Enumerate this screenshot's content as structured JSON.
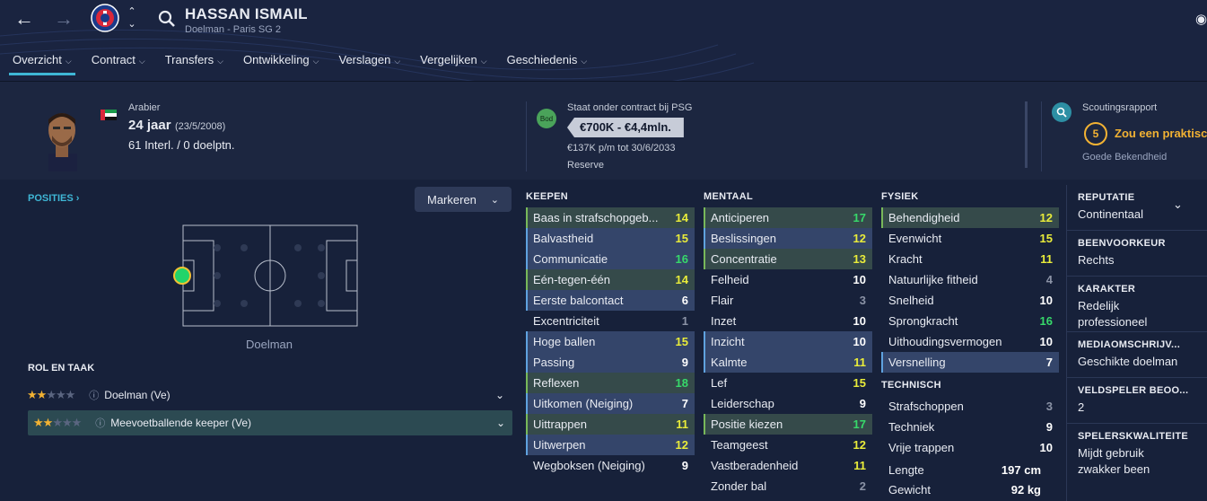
{
  "player": {
    "name": "HASSAN ISMAIL",
    "subtitle": "Doelman - Paris SG 2",
    "nationality": "Arabier",
    "age": "24 jaar",
    "dob": "(23/5/2008)",
    "caps": "61 Interl. / 0 doelptn."
  },
  "tabs": [
    {
      "label": "Overzicht"
    },
    {
      "label": "Contract"
    },
    {
      "label": "Transfers"
    },
    {
      "label": "Ontwikkeling"
    },
    {
      "label": "Verslagen"
    },
    {
      "label": "Vergelijken"
    },
    {
      "label": "Geschiedenis"
    }
  ],
  "contract": {
    "badge": "Bod",
    "heading": "Staat onder contract bij PSG",
    "value": "€700K - €4,4mln.",
    "wage": "€137K p/m tot 30/6/2033",
    "status": "Reserve"
  },
  "scouting": {
    "heading": "Scoutingsrapport",
    "score": "5",
    "verdict": "Zou een praktisc",
    "familiarity": "Goede Bekendheid"
  },
  "positions": {
    "title": "POSITIES",
    "mark_button": "Markeren",
    "position_label": "Doelman"
  },
  "role": {
    "title": "ROL EN TAAK",
    "roles": [
      {
        "label": "Doelman (Ve)",
        "stars": 2
      },
      {
        "label": "Meevoetballende keeper (Ve)",
        "stars": 2
      }
    ]
  },
  "attributes": {
    "keepen": {
      "title": "KEEPEN",
      "items": [
        {
          "name": "Baas in strafschopgeb...",
          "value": "14",
          "color": "y",
          "hl": "gr"
        },
        {
          "name": "Balvastheid",
          "value": "15",
          "color": "y",
          "hl": "hl"
        },
        {
          "name": "Communicatie",
          "value": "16",
          "color": "g",
          "hl": "hl"
        },
        {
          "name": "Eén-tegen-één",
          "value": "14",
          "color": "y",
          "hl": "gr"
        },
        {
          "name": "Eerste balcontact",
          "value": "6",
          "color": "w",
          "hl": "hl"
        },
        {
          "name": "Excentriciteit",
          "value": "1",
          "color": "gr",
          "hl": ""
        },
        {
          "name": "Hoge ballen",
          "value": "15",
          "color": "y",
          "hl": "hl"
        },
        {
          "name": "Passing",
          "value": "9",
          "color": "w",
          "hl": "hl"
        },
        {
          "name": "Reflexen",
          "value": "18",
          "color": "g",
          "hl": "gr"
        },
        {
          "name": "Uitkomen (Neiging)",
          "value": "7",
          "color": "w",
          "hl": "hl"
        },
        {
          "name": "Uittrappen",
          "value": "11",
          "color": "y",
          "hl": "gr"
        },
        {
          "name": "Uitwerpen",
          "value": "12",
          "color": "y",
          "hl": "hl"
        },
        {
          "name": "Wegboksen (Neiging)",
          "value": "9",
          "color": "w",
          "hl": ""
        }
      ]
    },
    "mentaal": {
      "title": "MENTAAL",
      "items": [
        {
          "name": "Anticiperen",
          "value": "17",
          "color": "g",
          "hl": "gr"
        },
        {
          "name": "Beslissingen",
          "value": "12",
          "color": "y",
          "hl": "hl"
        },
        {
          "name": "Concentratie",
          "value": "13",
          "color": "y",
          "hl": "gr"
        },
        {
          "name": "Felheid",
          "value": "10",
          "color": "w",
          "hl": ""
        },
        {
          "name": "Flair",
          "value": "3",
          "color": "gr",
          "hl": ""
        },
        {
          "name": "Inzet",
          "value": "10",
          "color": "w",
          "hl": ""
        },
        {
          "name": "Inzicht",
          "value": "10",
          "color": "w",
          "hl": "hl"
        },
        {
          "name": "Kalmte",
          "value": "11",
          "color": "y",
          "hl": "hl"
        },
        {
          "name": "Lef",
          "value": "15",
          "color": "y",
          "hl": ""
        },
        {
          "name": "Leiderschap",
          "value": "9",
          "color": "w",
          "hl": ""
        },
        {
          "name": "Positie kiezen",
          "value": "17",
          "color": "g",
          "hl": "gr"
        },
        {
          "name": "Teamgeest",
          "value": "12",
          "color": "y",
          "hl": ""
        },
        {
          "name": "Vastberadenheid",
          "value": "11",
          "color": "y",
          "hl": ""
        },
        {
          "name": "Zonder bal",
          "value": "2",
          "color": "gr",
          "hl": ""
        }
      ]
    },
    "fysiek": {
      "title": "FYSIEK",
      "items": [
        {
          "name": "Behendigheid",
          "value": "12",
          "color": "y",
          "hl": "gr"
        },
        {
          "name": "Evenwicht",
          "value": "15",
          "color": "y",
          "hl": ""
        },
        {
          "name": "Kracht",
          "value": "11",
          "color": "y",
          "hl": ""
        },
        {
          "name": "Natuurlijke fitheid",
          "value": "4",
          "color": "gr",
          "hl": ""
        },
        {
          "name": "Snelheid",
          "value": "10",
          "color": "w",
          "hl": ""
        },
        {
          "name": "Sprongkracht",
          "value": "16",
          "color": "g",
          "hl": ""
        },
        {
          "name": "Uithoudingsvermogen",
          "value": "10",
          "color": "w",
          "hl": ""
        },
        {
          "name": "Versnelling",
          "value": "7",
          "color": "w",
          "hl": "hl"
        }
      ]
    },
    "technisch": {
      "title": "TECHNISCH",
      "items": [
        {
          "name": "Strafschoppen",
          "value": "3",
          "color": "gr",
          "hl": ""
        },
        {
          "name": "Techniek",
          "value": "9",
          "color": "w",
          "hl": ""
        },
        {
          "name": "Vrije trappen",
          "value": "10",
          "color": "w",
          "hl": ""
        }
      ]
    },
    "physical_stats": [
      {
        "label": "Lengte",
        "value": "197 cm"
      },
      {
        "label": "Gewicht",
        "value": "92 kg"
      }
    ]
  },
  "info": [
    {
      "title": "REPUTATIE",
      "value": "Continentaal"
    },
    {
      "title": "BEENVOORKEUR",
      "value": "Rechts"
    },
    {
      "title": "KARAKTER",
      "value": "Redelijk professioneel"
    },
    {
      "title": "MEDIAOMSCHRIJV...",
      "value": "Geschikte doelman"
    },
    {
      "title": "VELDSPELER BEOO...",
      "value": "2"
    },
    {
      "title": "SPELERSKWALITEITE",
      "value": "Mijdt gebruik zwakker been"
    }
  ],
  "colors": {
    "accent": "#3fb7d6",
    "yellow": "#e9ec3a",
    "green": "#37d96a",
    "gold": "#f2b233"
  }
}
